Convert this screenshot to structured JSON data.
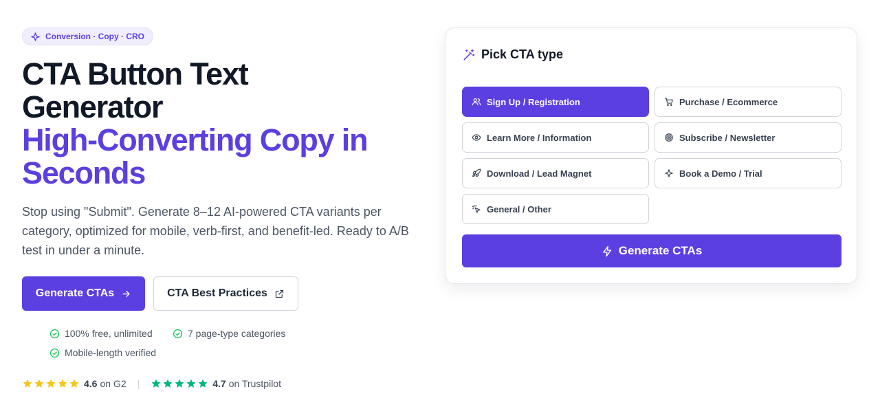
{
  "badge": {
    "label": "Conversion · Copy · CRO",
    "icon": "sparkle-icon"
  },
  "hero": {
    "title_line1": "CTA Button Text",
    "title_line2": "Generator",
    "accent_line1": "High-Converting Copy in",
    "accent_line2": "Seconds",
    "subtext": "Stop using \"Submit\". Generate 8–12 AI-powered CTA variants per category, optimized for mobile, verb-first, and benefit-led. Ready to A/B test in under a minute.",
    "primary_button": "Generate CTAs",
    "secondary_button": "CTA Best Practices"
  },
  "features": [
    "100% free, unlimited",
    "7 page-type categories",
    "Mobile-length verified"
  ],
  "ratings": {
    "g2": {
      "score": "4.6",
      "suffix": "on G2",
      "stars": 5
    },
    "trustpilot": {
      "score": "4.7",
      "suffix": "on Trustpilot",
      "stars": 5
    },
    "separator": "|"
  },
  "card": {
    "title": "Pick CTA type",
    "options": [
      {
        "label": "Sign Up / Registration",
        "icon": "users-icon",
        "selected": true
      },
      {
        "label": "Purchase / Ecommerce",
        "icon": "cart-icon",
        "selected": false
      },
      {
        "label": "Learn More / Information",
        "icon": "eye-icon",
        "selected": false
      },
      {
        "label": "Subscribe / Newsletter",
        "icon": "target-icon",
        "selected": false
      },
      {
        "label": "Download / Lead Magnet",
        "icon": "rocket-icon",
        "selected": false
      },
      {
        "label": "Book a Demo / Trial",
        "icon": "sparkle-icon",
        "selected": false
      },
      {
        "label": "General / Other",
        "icon": "click-icon",
        "selected": false
      }
    ],
    "generate_button": "Generate CTAs"
  },
  "colors": {
    "accent": "#5b3fe0",
    "star_g2": "#f5c518",
    "star_trustpilot": "#00b67a",
    "check_green": "#22c55e"
  }
}
